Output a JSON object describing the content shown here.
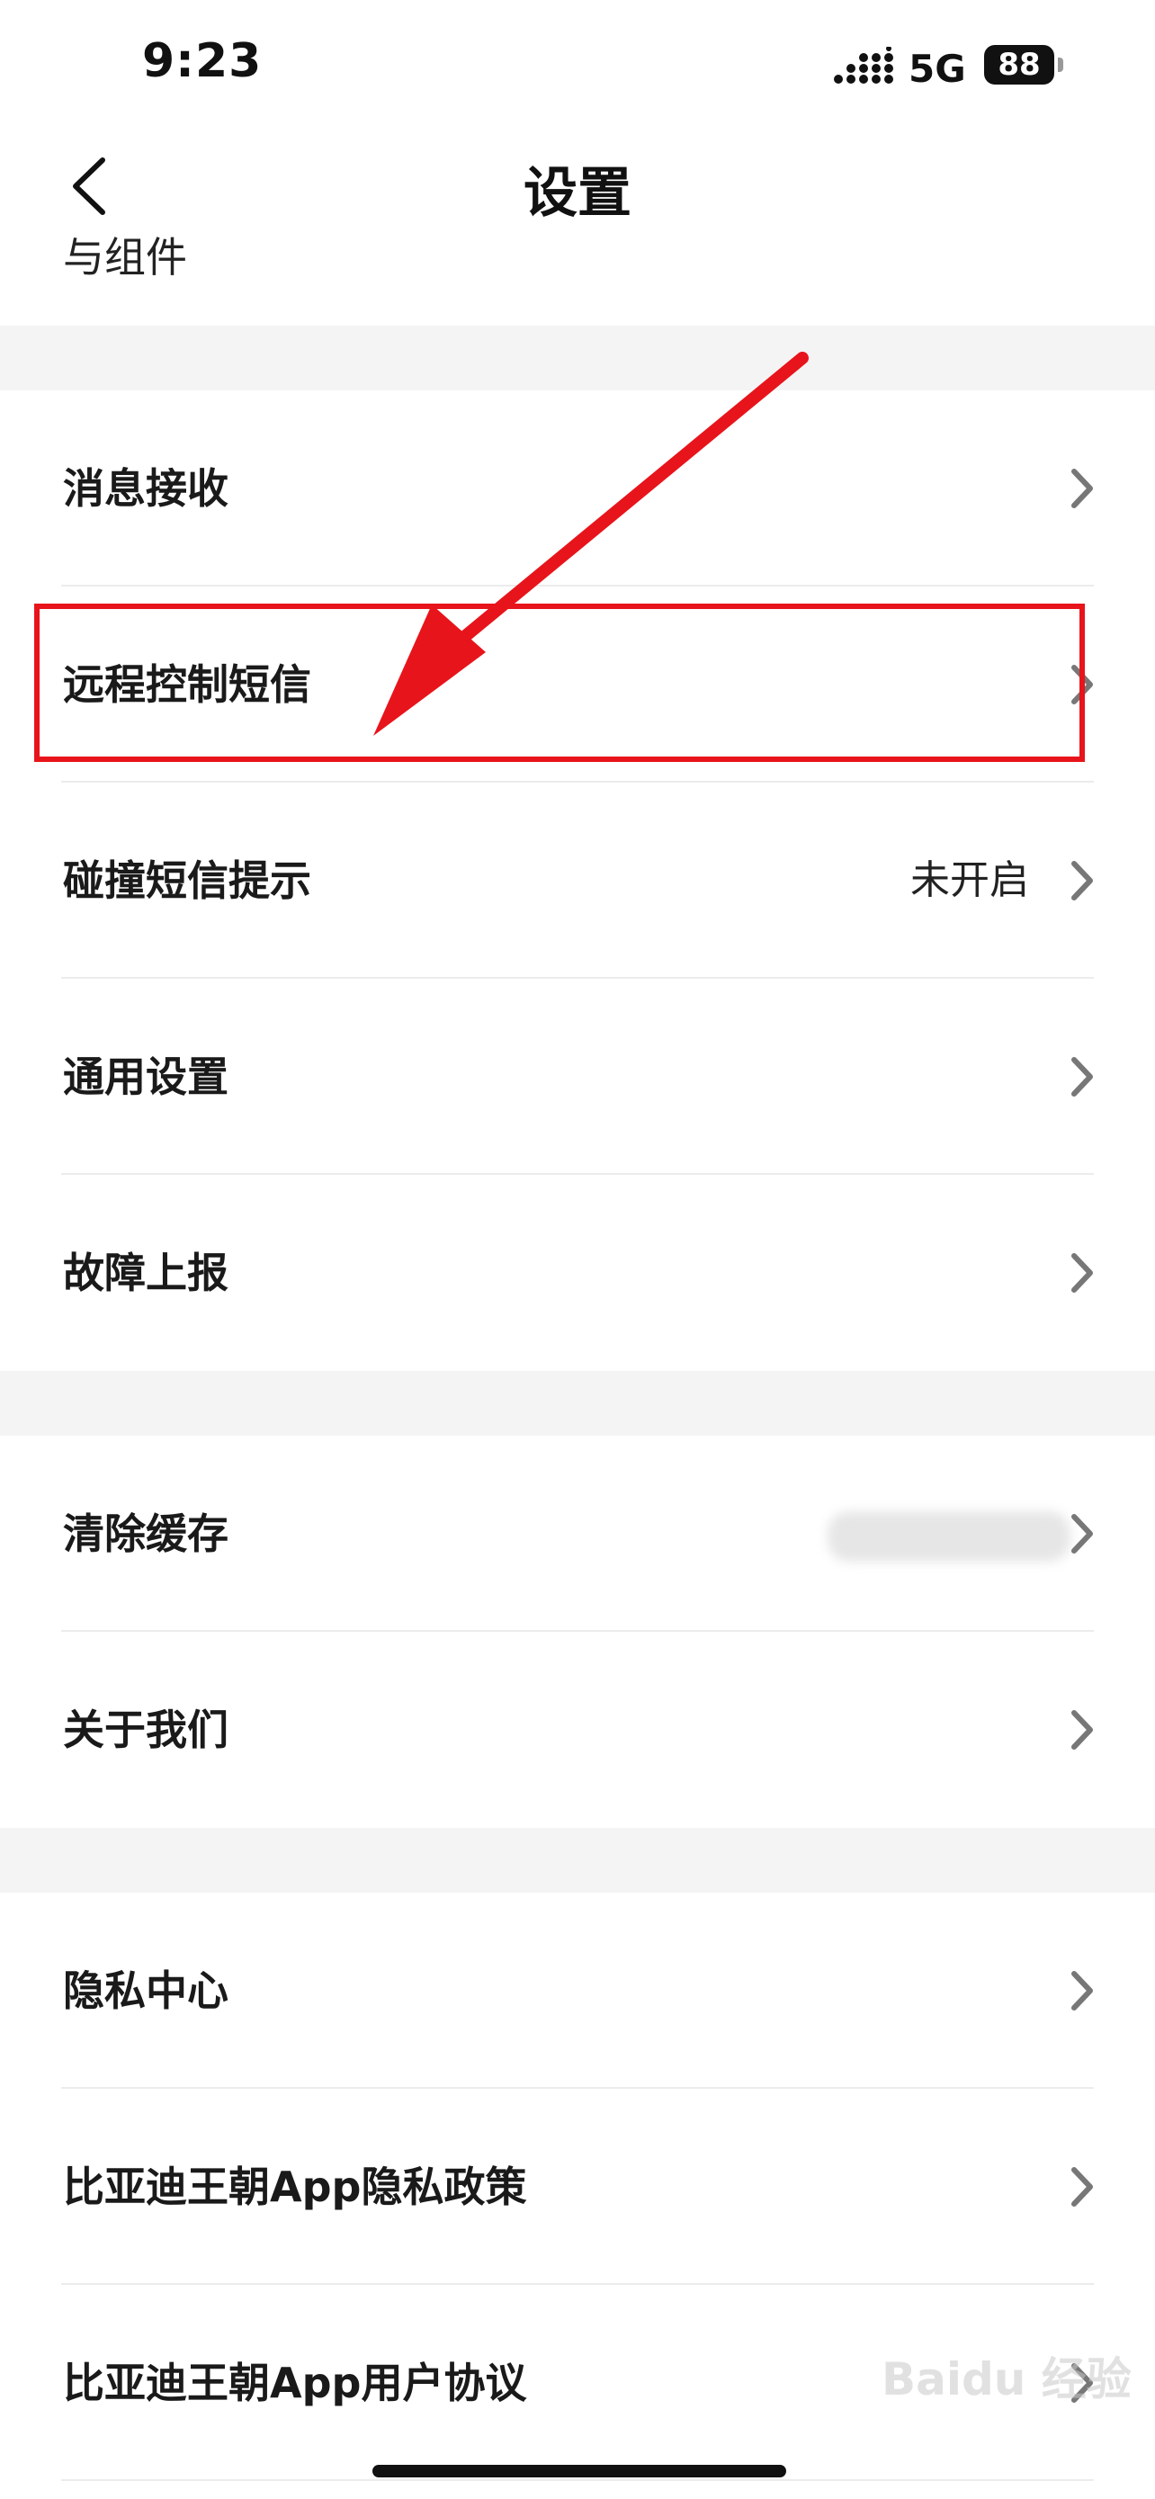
{
  "status_bar": {
    "time": "9:23",
    "network": "5G",
    "battery": "88"
  },
  "nav": {
    "title": "设置"
  },
  "partial_row": {
    "text": "与组件"
  },
  "rows": [
    {
      "label": "消息接收",
      "value": ""
    },
    {
      "label": "远程控制短信",
      "value": ""
    },
    {
      "label": "碰撞短信提示",
      "value": "未开启"
    },
    {
      "label": "通用设置",
      "value": ""
    },
    {
      "label": "故障上报",
      "value": ""
    },
    {
      "label": "清除缓存",
      "value": ""
    },
    {
      "label": "关于我们",
      "value": ""
    },
    {
      "label": "隐私中心",
      "value": ""
    },
    {
      "label": "比亚迪王朝App隐私政策",
      "value": ""
    },
    {
      "label": "比亚迪王朝App用户协议",
      "value": ""
    }
  ],
  "annotation": {
    "highlight_color": "#e8141b"
  },
  "watermark": "Baidu 经验"
}
